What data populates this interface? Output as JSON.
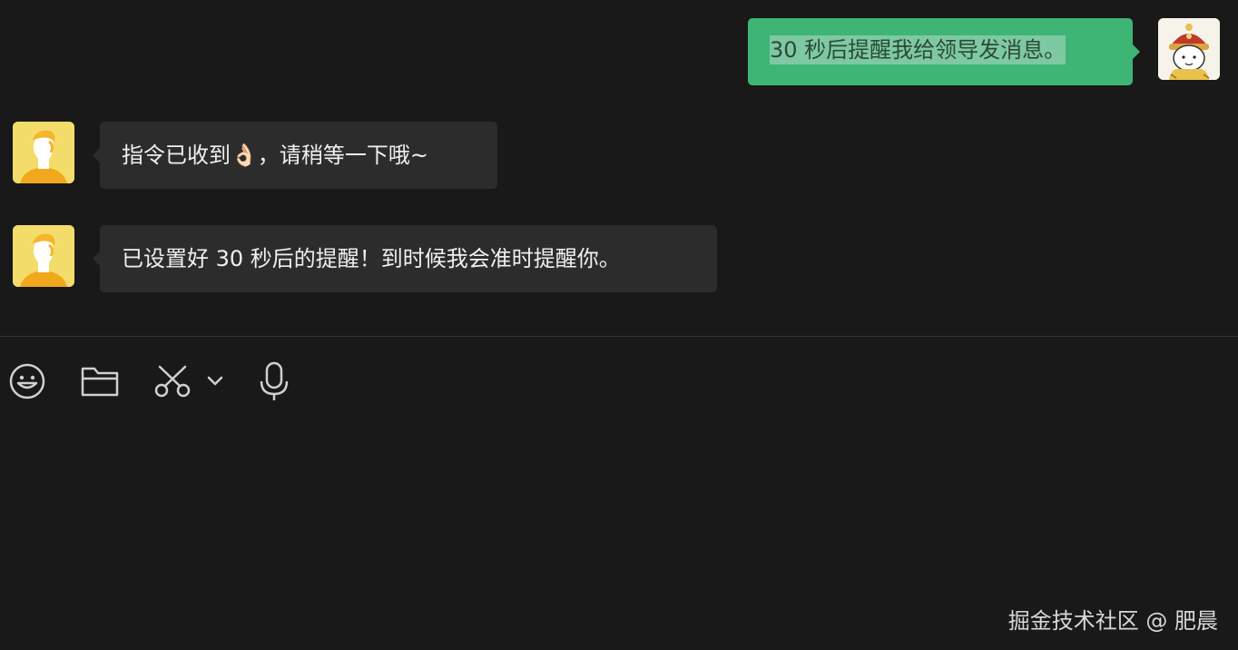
{
  "messages": [
    {
      "side": "outgoing",
      "text": "30 秒后提醒我给领导发消息。",
      "selected": true,
      "avatar_icon": "emperor-cartoon-avatar"
    },
    {
      "side": "incoming",
      "text": "指令已收到👌🏻，请稍等一下哦~",
      "avatar_icon": "yellow-person-avatar"
    },
    {
      "side": "incoming",
      "text": "已设置好 30 秒后的提醒！到时候我会准时提醒你。",
      "avatar_icon": "yellow-person-avatar"
    }
  ],
  "toolbar": {
    "items": [
      "emoji-icon",
      "folder-icon",
      "scissors-icon",
      "chevron-down-icon",
      "microphone-icon"
    ]
  },
  "watermark": "掘金技术社区 @ 肥晨",
  "colors": {
    "background": "#191919",
    "incoming_bubble": "#2c2c2c",
    "outgoing_bubble": "#3eb575",
    "selection": "#7ec9a2",
    "avatar_yellow": "#f4dc6a"
  }
}
